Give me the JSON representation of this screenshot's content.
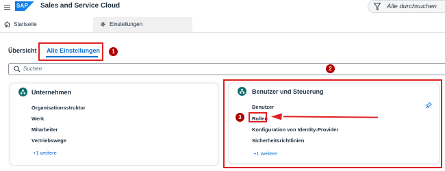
{
  "shell": {
    "logo": "SAP",
    "title": "Sales and Service Cloud",
    "search_placeholder": "Alle durchsuchen"
  },
  "tabs": [
    {
      "label": "Startseite",
      "icon": "home-icon"
    },
    {
      "label": "Einstellungen",
      "icon": "gear-icon"
    }
  ],
  "subtabs": {
    "overview": "Übersicht",
    "all": "Alle Einstellungen"
  },
  "search": {
    "placeholder": "Suchen"
  },
  "badges": [
    "1",
    "2",
    "3"
  ],
  "cards": {
    "company": {
      "title": "Unternehmen",
      "items": [
        "Organisationsstruktur",
        "Werk",
        "Mitarbeiter",
        "Vertriebswege"
      ],
      "more": "+1 weitere"
    },
    "users": {
      "title": "Benutzer und Steuerung",
      "items": [
        "Benutzer",
        "Rollen",
        "Konfiguration von Identity-Provider",
        "Sicherheitsrichtlinien"
      ],
      "more": "+1 weitere"
    }
  },
  "colors": {
    "accent": "#0a6ed1",
    "annotation_red": "#e02020",
    "badge_red": "#b00000",
    "card_icon_teal": "#0f6d6f"
  }
}
